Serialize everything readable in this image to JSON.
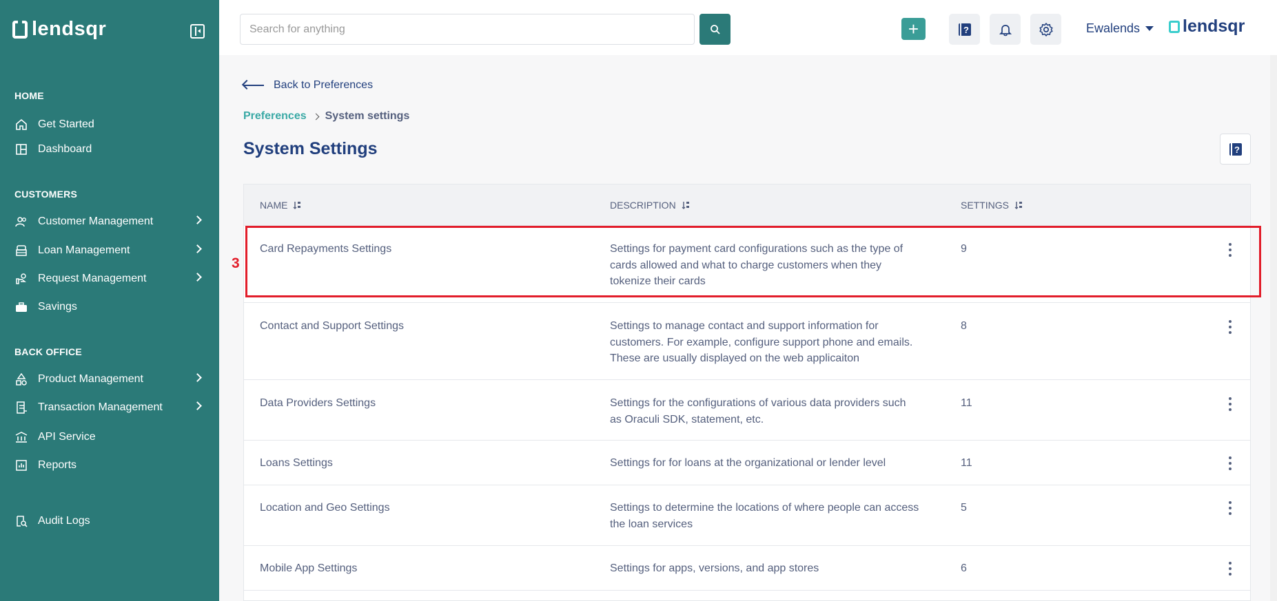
{
  "brand": {
    "name": "lendsqr"
  },
  "sidebar": {
    "sections": [
      {
        "title": "HOME"
      },
      {
        "title": "CUSTOMERS"
      },
      {
        "title": "BACK OFFICE"
      }
    ],
    "items": [
      {
        "label": "Get Started",
        "icon": "home-icon"
      },
      {
        "label": "Dashboard",
        "icon": "dashboard-icon"
      },
      {
        "label": "Customer Management",
        "icon": "users-icon"
      },
      {
        "label": "Loan Management",
        "icon": "bank-icon"
      },
      {
        "label": "Request Management",
        "icon": "hand-money-icon"
      },
      {
        "label": "Savings",
        "icon": "briefcase-icon"
      },
      {
        "label": "Product Management",
        "icon": "shapes-icon"
      },
      {
        "label": "Transaction Management",
        "icon": "document-icon"
      },
      {
        "label": "API Service",
        "icon": "institution-icon"
      },
      {
        "label": "Reports",
        "icon": "chart-icon"
      },
      {
        "label": "Audit Logs",
        "icon": "audit-icon"
      }
    ]
  },
  "topbar": {
    "search_placeholder": "Search for anything",
    "add_label": "+",
    "user_name": "Ewalends",
    "brand_text": "lendsqr"
  },
  "main": {
    "back_label": "Back to Preferences",
    "breadcrumb": {
      "parent": "Preferences",
      "current": "System settings"
    },
    "title": "System Settings",
    "marker": "3",
    "table": {
      "headers": {
        "name": "NAME",
        "description": "DESCRIPTION",
        "settings": "SETTINGS"
      },
      "rows": [
        {
          "name": "Card Repayments Settings",
          "description": "Settings for payment card configurations such as the type of cards allowed and what to charge customers when they tokenize their cards",
          "settings": "9"
        },
        {
          "name": "Contact and Support Settings",
          "description": "Settings to manage contact and support information for customers. For example, configure support phone and emails. These are usually displayed on the web applicaiton",
          "settings": "8"
        },
        {
          "name": "Data Providers Settings",
          "description": "Settings for the configurations of various data providers such as Oraculi SDK, statement, etc.",
          "settings": "11"
        },
        {
          "name": "Loans Settings",
          "description": "Settings for for loans at the organizational or lender level",
          "settings": "11"
        },
        {
          "name": "Location and Geo Settings",
          "description": "Settings to determine the locations of where people can access the loan services",
          "settings": "5"
        },
        {
          "name": "Mobile App Settings",
          "description": "Settings for apps, versions, and app stores",
          "settings": "6"
        }
      ]
    }
  },
  "colors": {
    "sidebar": "#2b7a78",
    "accent": "#39a9a5",
    "title": "#213f7d",
    "highlight": "#e21d2a"
  }
}
